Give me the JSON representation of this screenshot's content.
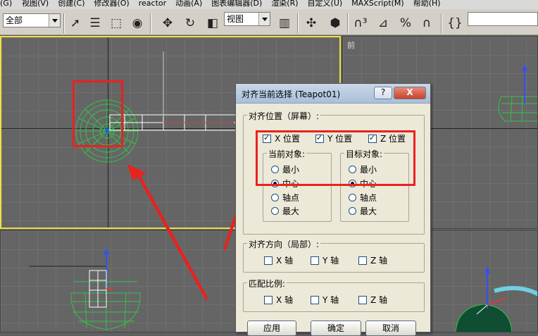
{
  "menubar": [
    "(G)",
    "视图(V)",
    "创建(C)",
    "修改器(O)",
    "reactor",
    "动画(A)",
    "图表编辑器(D)",
    "渲染(R)",
    "自定义(U)",
    "MAXScript(M)",
    "帮助(H)"
  ],
  "toolbar": {
    "selection_filter": "全部",
    "reference_coord": "视图",
    "named_selection": ""
  },
  "viewports": {
    "top_right_label": "前"
  },
  "dialog": {
    "title": "对齐当前选择 (Teapot01)",
    "help_btn": "?",
    "close_btn": "X",
    "align_position_legend": "对齐位置（屏幕）:",
    "x_pos": "X 位置",
    "y_pos": "Y 位置",
    "z_pos": "Z 位置",
    "current_obj_legend": "当前对象:",
    "target_obj_legend": "目标对象:",
    "opt_min": "最小",
    "opt_center": "中心",
    "opt_pivot": "轴点",
    "opt_max": "最大",
    "orient_legend": "对齐方向（局部）:",
    "scale_legend": "匹配比例:",
    "x_axis": "X 轴",
    "y_axis": "Y 轴",
    "z_axis": "Z 轴",
    "apply": "应用",
    "ok": "确定",
    "cancel": "取消"
  },
  "colors": {
    "annotation_red": "#e8221f",
    "wireframe_green": "#33c24a",
    "viewport_bg": "#656565",
    "active_viewport_border": "#f0e040"
  }
}
